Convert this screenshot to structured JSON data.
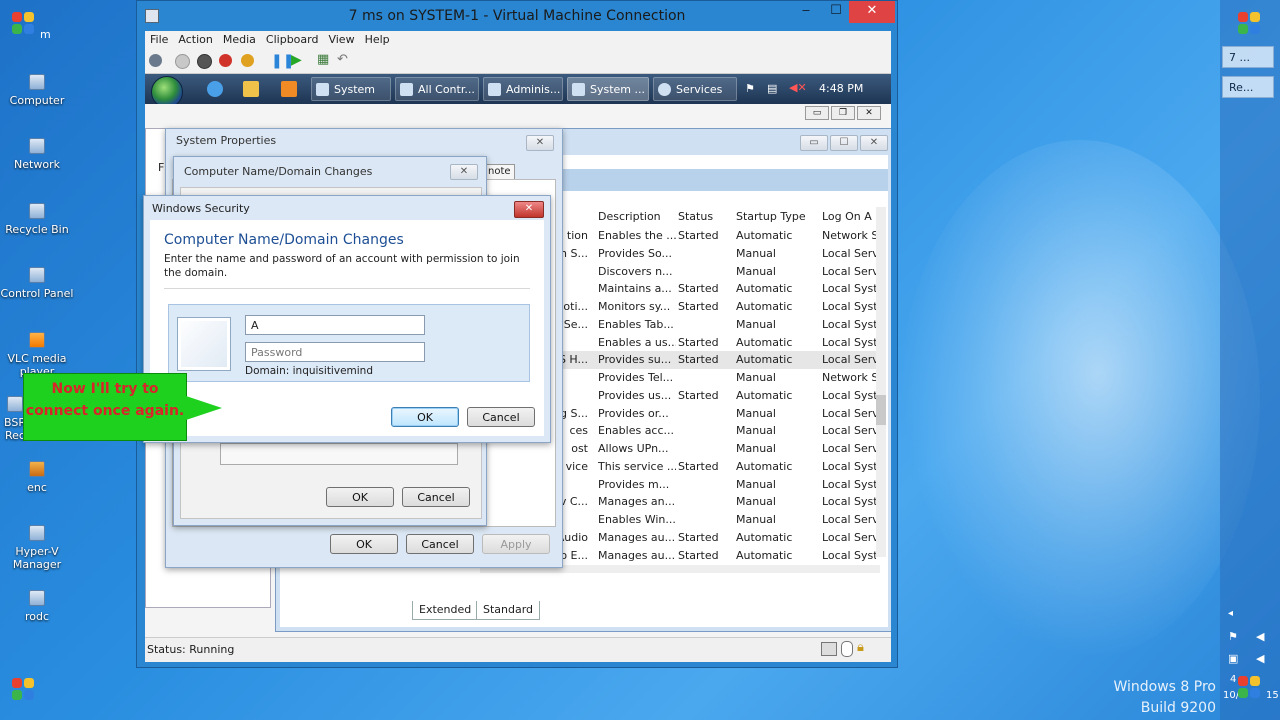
{
  "vm": {
    "title": "7 ms on SYSTEM-1 - Virtual Machine Connection",
    "menu": [
      "File",
      "Action",
      "Media",
      "Clipboard",
      "View",
      "Help"
    ],
    "status": "Status: Running"
  },
  "desktop": {
    "icons": [
      "Computer",
      "Network",
      "Recycle Bin",
      "Control Panel",
      "VLC media player",
      "BSR Rec",
      "enc",
      "Hyper-V Manager",
      "rodc"
    ],
    "top_label": "m",
    "os_name": "Windows 8 Pro",
    "build": "Build 9200",
    "right_buttons": [
      "7 ...",
      "Re..."
    ],
    "corner_clock": "4",
    "corner_date": "10/",
    "corner_suffix": "15"
  },
  "guest_taskbar": {
    "tasks": [
      "System",
      "All Contr...",
      "Adminis...",
      "System ...",
      "Services"
    ],
    "clock": "4:48 PM"
  },
  "services": {
    "columns": [
      "Description",
      "Status",
      "Startup Type",
      "Log On A"
    ],
    "rows": [
      {
        "name": "tion",
        "desc": "Enables the ...",
        "status": "Started",
        "startup": "Automatic",
        "logon": "Network S"
      },
      {
        "name": "n S...",
        "desc": "Provides So...",
        "status": "",
        "startup": "Manual",
        "logon": "Local Serv"
      },
      {
        "name": "",
        "desc": "Discovers n...",
        "status": "",
        "startup": "Manual",
        "logon": "Local Serv"
      },
      {
        "name": "",
        "desc": "Maintains a...",
        "status": "Started",
        "startup": "Automatic",
        "logon": "Local Syst"
      },
      {
        "name": "oti...",
        "desc": "Monitors sy...",
        "status": "Started",
        "startup": "Automatic",
        "logon": "Local Syst"
      },
      {
        "name": "Se...",
        "desc": "Enables Tab...",
        "status": "",
        "startup": "Manual",
        "logon": "Local Syst"
      },
      {
        "name": "",
        "desc": "Enables a us...",
        "status": "Started",
        "startup": "Automatic",
        "logon": "Local Syst"
      },
      {
        "name": "S H...",
        "desc": "Provides su...",
        "status": "Started",
        "startup": "Automatic",
        "logon": "Local Serv"
      },
      {
        "name": "",
        "desc": "Provides Tel...",
        "status": "",
        "startup": "Manual",
        "logon": "Network S"
      },
      {
        "name": "",
        "desc": "Provides us...",
        "status": "Started",
        "startup": "Automatic",
        "logon": "Local Syst"
      },
      {
        "name": "g S...",
        "desc": "Provides or...",
        "status": "",
        "startup": "Manual",
        "logon": "Local Serv"
      },
      {
        "name": "ces",
        "desc": "Enables acc...",
        "status": "",
        "startup": "Manual",
        "logon": "Local Serv"
      },
      {
        "name": "ost",
        "desc": "Allows UPn...",
        "status": "",
        "startup": "Manual",
        "logon": "Local Serv"
      },
      {
        "name": "vice",
        "desc": "This service ...",
        "status": "Started",
        "startup": "Automatic",
        "logon": "Local Syst"
      },
      {
        "name": "",
        "desc": "Provides m...",
        "status": "",
        "startup": "Manual",
        "logon": "Local Syst"
      },
      {
        "name": "v C...",
        "desc": "Manages an...",
        "status": "",
        "startup": "Manual",
        "logon": "Local Syst"
      },
      {
        "name": "",
        "desc": "Enables Win...",
        "status": "",
        "startup": "Manual",
        "logon": "Local Serv"
      },
      {
        "name": "Windows Audio",
        "desc": "Manages au...",
        "status": "Started",
        "startup": "Automatic",
        "logon": "Local Serv"
      },
      {
        "name": "Windows Audio E...",
        "desc": "Manages au...",
        "status": "Started",
        "startup": "Automatic",
        "logon": "Local Syst"
      }
    ],
    "tabs": [
      "Extended",
      "Standard"
    ]
  },
  "system_properties": {
    "title": "System Properties",
    "partial_label": "F",
    "partial_tab": "note",
    "ok": "OK",
    "cancel": "Cancel",
    "apply": "Apply"
  },
  "domain_changes": {
    "title": "Computer Name/Domain Changes",
    "ok": "OK",
    "cancel": "Cancel"
  },
  "windows_security": {
    "title": "Windows Security",
    "heading": "Computer Name/Domain Changes",
    "description": "Enter the name and password of an account with permission to join the domain.",
    "username_value": "A",
    "password_placeholder": "Password",
    "domain": "Domain: inquisitivemind",
    "ok": "OK",
    "cancel": "Cancel"
  },
  "callout": {
    "line1": "Now I'll try to",
    "line2": "connect once again."
  },
  "colors": {
    "callout_bg": "#1fd11f",
    "callout_text": "#d9242a",
    "close_red": "#e04343",
    "heading_blue": "#1e4f95"
  }
}
